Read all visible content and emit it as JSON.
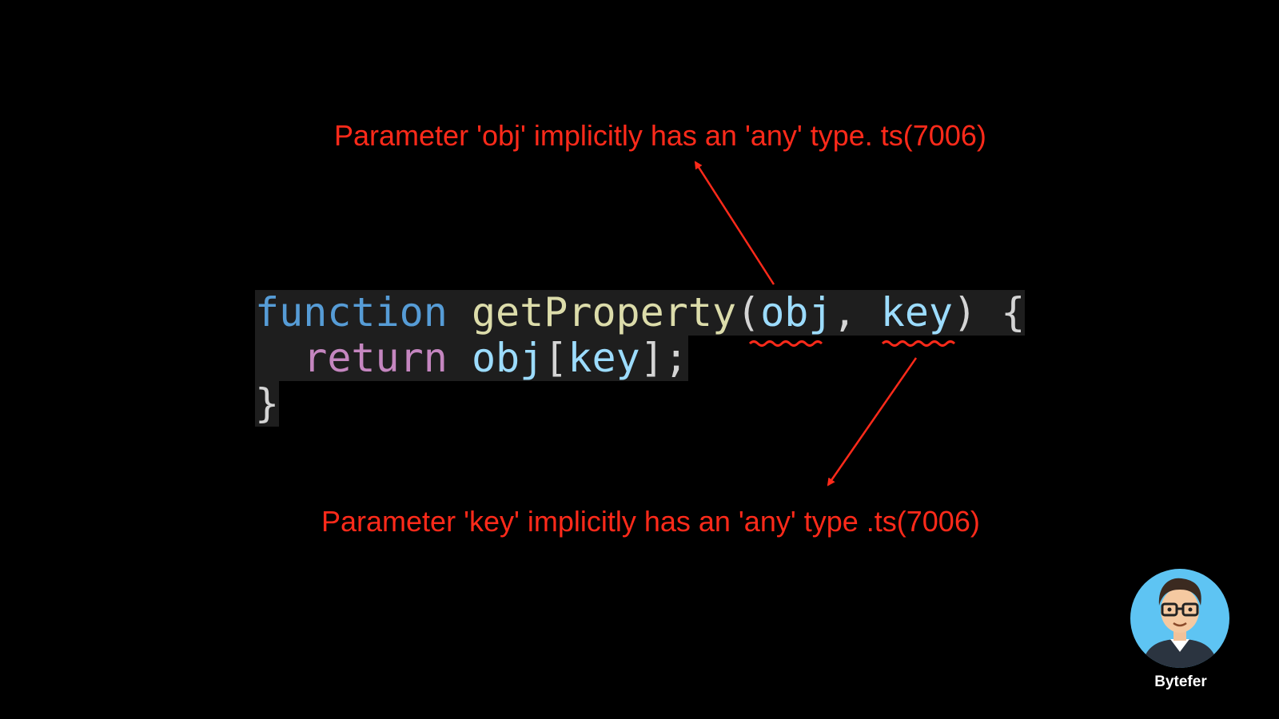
{
  "annotations": {
    "obj_error": "Parameter 'obj' implicitly has an 'any' type. ts(7006)",
    "key_error": "Parameter 'key' implicitly has an 'any' type .ts(7006)"
  },
  "code": {
    "line1": {
      "keyword": "function",
      "space1": " ",
      "name": "getProperty",
      "open_paren": "(",
      "param1": "obj",
      "comma": ", ",
      "param2": "key",
      "close": ") {"
    },
    "line2": {
      "indent": "  ",
      "keyword": "return",
      "space": " ",
      "object": "obj",
      "open_bracket": "[",
      "key": "key",
      "close": "];"
    },
    "line3": {
      "brace": "}"
    }
  },
  "brand": {
    "name": "Bytefer"
  },
  "colors": {
    "background": "#000000",
    "annotation": "#ff2a1a",
    "code_background": "#1e1e1e",
    "keyword_function": "#569cd6",
    "function_name": "#dcdcaa",
    "parameter": "#9cdcfe",
    "keyword_return": "#c586c0",
    "avatar_background": "#5ec4f3"
  }
}
